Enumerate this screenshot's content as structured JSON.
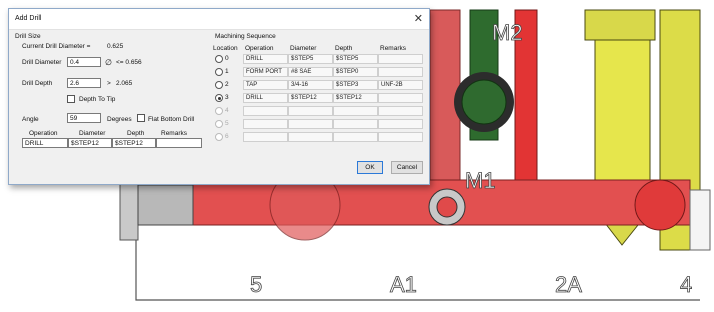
{
  "cad": {
    "labels": {
      "m2": "M2",
      "m1": "M1",
      "p5": "5",
      "a1": "A1",
      "a2": "2A",
      "p4": "4"
    }
  },
  "dialog": {
    "title": "Add Drill",
    "drill_size": {
      "group_label": "Drill Size",
      "current_label": "Current Drill Diameter =",
      "current_value": "0.625",
      "diameter_label": "Drill Diameter",
      "diameter_value": "0.4",
      "diameter_limit": "<= 0.656",
      "depth_label": "Drill Depth",
      "depth_value": "2.6",
      "depth_limit": "2.065",
      "depth_to_tip_label": "Depth To Tip",
      "angle_label": "Angle",
      "angle_value": "59",
      "degrees_label": "Degrees",
      "flat_bottom_label": "Flat Bottom Drill",
      "op_headers": [
        "Operation",
        "Diameter",
        "Depth",
        "Remarks"
      ],
      "op_values": [
        "DRILL",
        "$STEP12",
        "$STEP12",
        ""
      ]
    },
    "machining": {
      "group_label": "Machining Sequence",
      "headers": [
        "Location",
        "Operation",
        "Diameter",
        "Depth",
        "Remarks"
      ],
      "rows": [
        {
          "loc": "0",
          "cells": [
            "DRILL",
            "$STEP5",
            "$STEP5",
            ""
          ]
        },
        {
          "loc": "1",
          "cells": [
            "FORM PORT",
            "#8 SAE",
            "$STEP0",
            ""
          ]
        },
        {
          "loc": "2",
          "cells": [
            "TAP",
            "3/4-16",
            "$STEP3",
            "UNF-2B"
          ]
        },
        {
          "loc": "3",
          "cells": [
            "DRILL",
            "$STEP12",
            "$STEP12",
            ""
          ]
        },
        {
          "loc": "4",
          "cells": [
            "",
            "",
            "",
            ""
          ]
        },
        {
          "loc": "5",
          "cells": [
            "",
            "",
            "",
            ""
          ]
        },
        {
          "loc": "6",
          "cells": [
            "",
            "",
            "",
            ""
          ]
        }
      ],
      "selected_index": 3
    },
    "buttons": {
      "ok": "OK",
      "cancel": "Cancel"
    }
  }
}
